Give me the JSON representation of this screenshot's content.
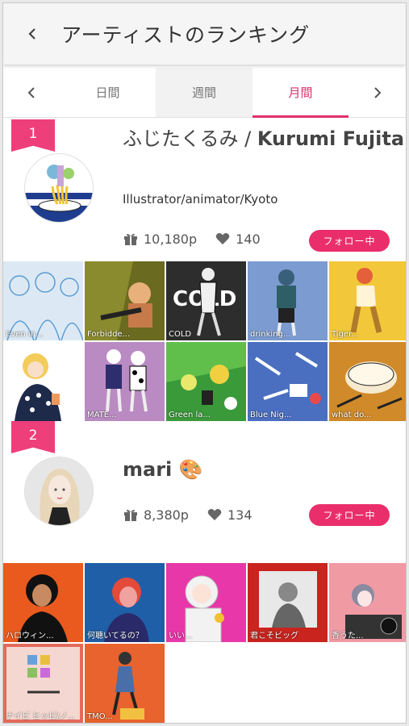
{
  "header": {
    "title": "アーティストのランキング"
  },
  "tabs": [
    {
      "label": "日間"
    },
    {
      "label": "週間"
    },
    {
      "label": "月間"
    }
  ],
  "artists": [
    {
      "rank": "1",
      "name_jp": "ふじたくるみ / ",
      "name_en": "Kurumi Fujita",
      "bio": "Illustrator/animator/Kyoto",
      "points": "10,180p",
      "likes": "140",
      "follow_label": "フォロー中",
      "works": [
        {
          "caption": "Even in..."
        },
        {
          "caption": "Forbidde..."
        },
        {
          "caption": "COLD"
        },
        {
          "caption": "drinking..."
        },
        {
          "caption": "Tiger..."
        },
        {
          "caption": ""
        },
        {
          "caption": "MATE..."
        },
        {
          "caption": "Green la..."
        },
        {
          "caption": "Blue Nig..."
        },
        {
          "caption": "what do..."
        }
      ]
    },
    {
      "rank": "2",
      "name": "mari",
      "emoji": "🎨",
      "points": "8,380p",
      "likes": "134",
      "follow_label": "フォロー中",
      "works": [
        {
          "caption": "ハロウィン..."
        },
        {
          "caption": "何聴いてるの？"
        },
        {
          "caption": "いい..."
        },
        {
          "caption": "君こそビッグ"
        },
        {
          "caption": "香うた..."
        },
        {
          "caption": "ナイビ ヒッピ/ノ..."
        },
        {
          "caption": "TMO..."
        }
      ]
    }
  ],
  "colors": {
    "accent": "#ea2e6c",
    "badge": "#ef3f7b"
  }
}
